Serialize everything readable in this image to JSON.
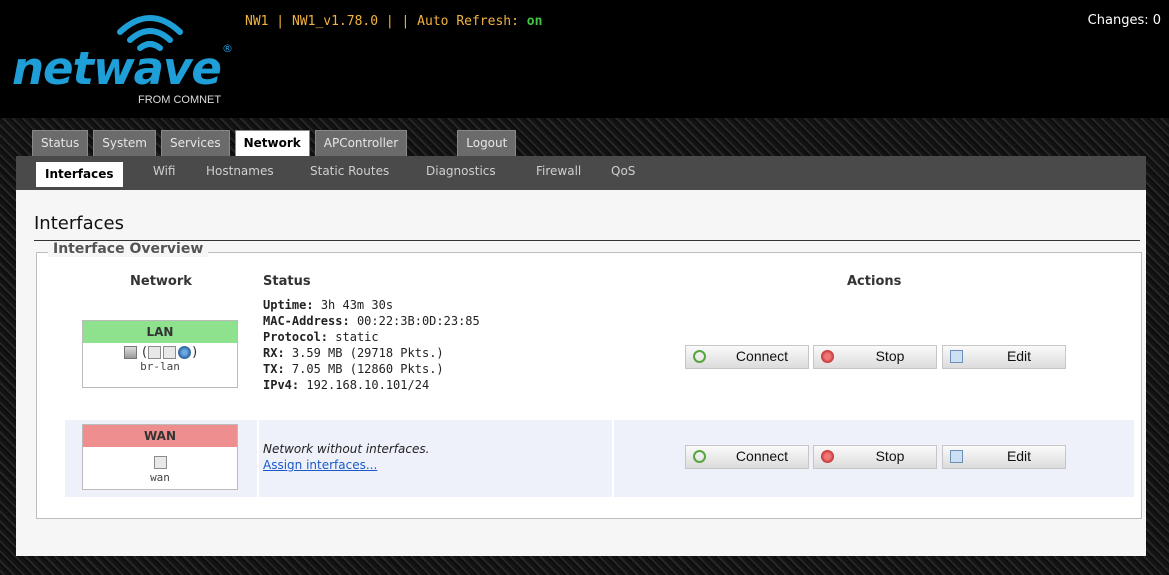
{
  "brand": {
    "name": "netwave",
    "sub": "FROM COMNET",
    "reg": "®"
  },
  "topbar": {
    "info": "NW1 | NW1_v1.78.0 | | Auto Refresh: ",
    "auto_refresh": "on",
    "changes": "Changes: 0"
  },
  "tabs": [
    "Status",
    "System",
    "Services",
    "Network",
    "APController",
    "Logout"
  ],
  "active_tab": "Network",
  "subtabs": [
    "Interfaces",
    "Wifi",
    "Hostnames",
    "Static Routes",
    "Diagnostics",
    "Firewall",
    "QoS"
  ],
  "active_subtab": "Interfaces",
  "page": {
    "title": "Interfaces",
    "section": "Interface Overview"
  },
  "table": {
    "headers": {
      "network": "Network",
      "status": "Status",
      "actions": "Actions"
    }
  },
  "rows": [
    {
      "name": "LAN",
      "color": "#8ee28e",
      "device": "br-lan",
      "icons_text": "(",
      "icons_close": ")",
      "status": {
        "uptime_label": "Uptime:",
        "uptime": "3h 43m 30s",
        "mac_label": "MAC-Address:",
        "mac": "00:22:3B:0D:23:85",
        "proto_label": "Protocol:",
        "proto": "static",
        "rx_label": "RX:",
        "rx": "3.59 MB (29718 Pkts.)",
        "tx_label": "TX:",
        "tx": "7.05 MB (12860 Pkts.)",
        "ipv4_label": "IPv4:",
        "ipv4": "192.168.10.101/24"
      }
    },
    {
      "name": "WAN",
      "color": "#ee8e8e",
      "device": "wan",
      "status": {
        "note": "Network without interfaces.",
        "link": "Assign interfaces..."
      }
    }
  ],
  "actions": {
    "connect": "Connect",
    "stop": "Stop",
    "edit": "Edit"
  }
}
